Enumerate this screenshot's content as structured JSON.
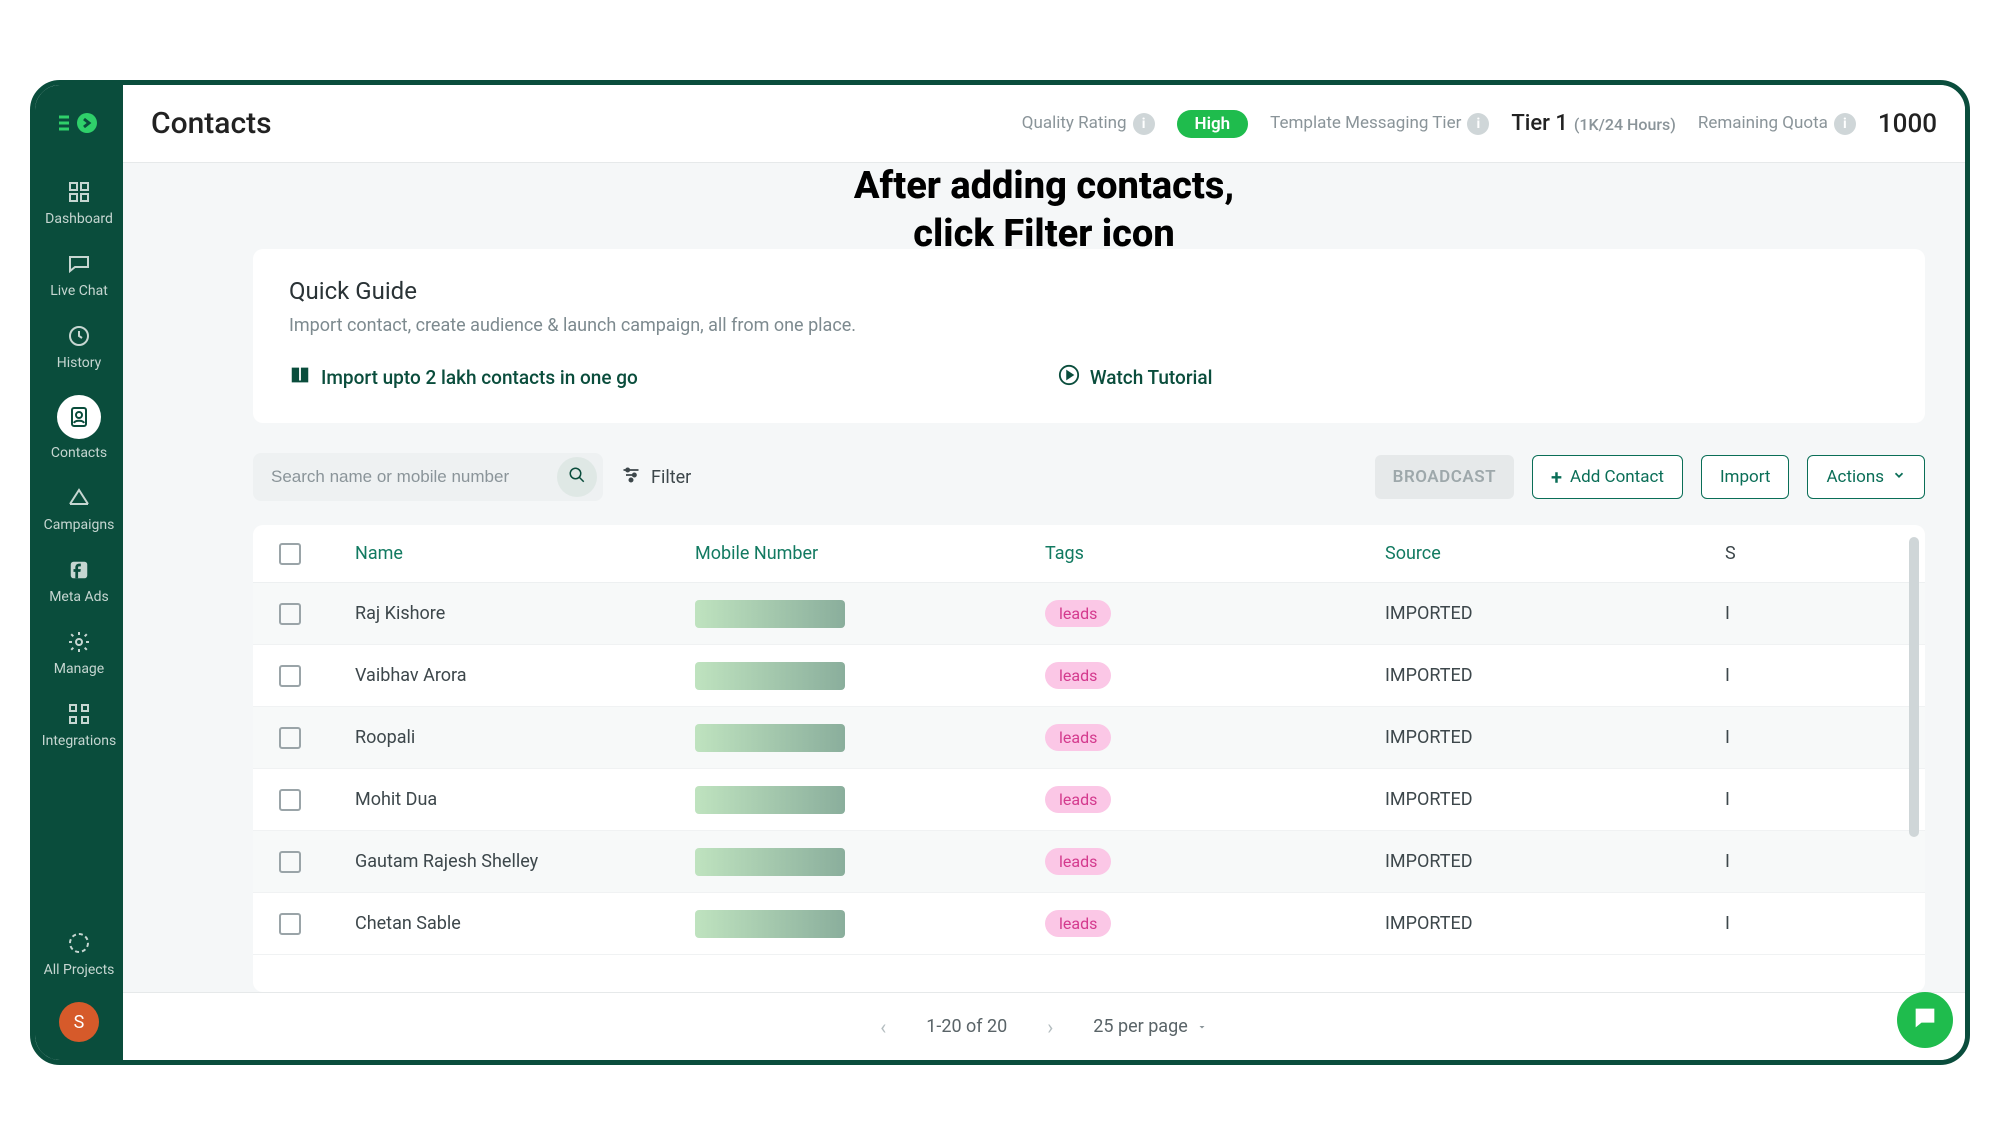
{
  "annotation": {
    "line1": "After adding contacts,",
    "line2": "click Filter icon"
  },
  "sidebar": {
    "items": [
      {
        "label": "Dashboard"
      },
      {
        "label": "Live Chat"
      },
      {
        "label": "History"
      },
      {
        "label": "Contacts"
      },
      {
        "label": "Campaigns"
      },
      {
        "label": "Meta Ads"
      },
      {
        "label": "Manage"
      },
      {
        "label": "Integrations"
      },
      {
        "label": "All Projects"
      }
    ],
    "avatar_initial": "S"
  },
  "header": {
    "title": "Contacts",
    "quality_label": "Quality Rating",
    "quality_value": "High",
    "tier_label": "Template Messaging Tier",
    "tier_value": "Tier 1",
    "tier_sub": "(1K/24 Hours)",
    "quota_label": "Remaining Quota",
    "quota_value": "1000"
  },
  "guide": {
    "title": "Quick Guide",
    "subtitle": "Import contact, create audience & launch campaign, all from one place.",
    "import_link": "Import upto 2 lakh contacts in one go",
    "tutorial_link": "Watch Tutorial"
  },
  "toolbar": {
    "search_placeholder": "Search name or mobile number",
    "filter_label": "Filter",
    "broadcast_label": "BROADCAST",
    "add_contact_label": "Add Contact",
    "import_label": "Import",
    "actions_label": "Actions"
  },
  "table": {
    "columns": {
      "name": "Name",
      "mobile": "Mobile Number",
      "tags": "Tags",
      "source": "Source",
      "extra": "S"
    },
    "rows": [
      {
        "name": "Raj Kishore",
        "tag": "leads",
        "source": "IMPORTED",
        "extra": "I"
      },
      {
        "name": "Vaibhav Arora",
        "tag": "leads",
        "source": "IMPORTED",
        "extra": "I"
      },
      {
        "name": "Roopali",
        "tag": "leads",
        "source": "IMPORTED",
        "extra": "I"
      },
      {
        "name": "Mohit Dua",
        "tag": "leads",
        "source": "IMPORTED",
        "extra": "I"
      },
      {
        "name": "Gautam Rajesh Shelley",
        "tag": "leads",
        "source": "IMPORTED",
        "extra": "I"
      },
      {
        "name": "Chetan Sable",
        "tag": "leads",
        "source": "IMPORTED",
        "extra": "I"
      }
    ]
  },
  "pagination": {
    "range": "1-20 of 20",
    "per_page": "25 per page"
  }
}
